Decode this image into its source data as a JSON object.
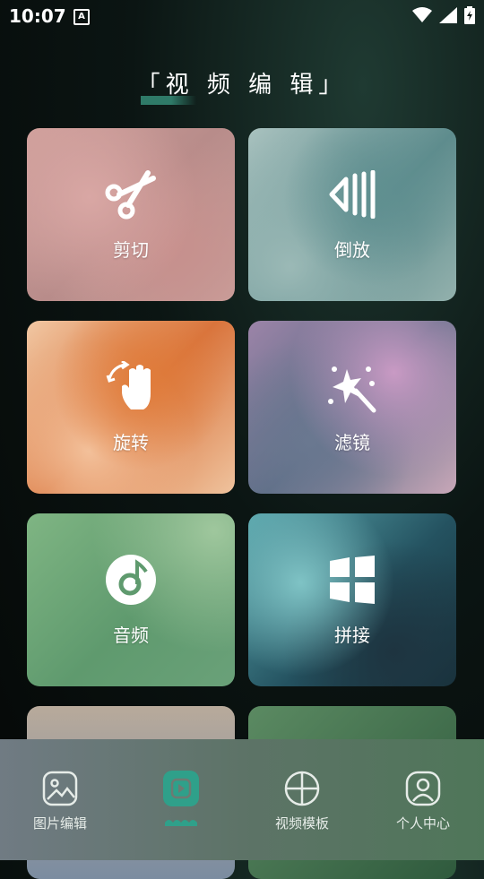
{
  "status_bar": {
    "time": "10:07",
    "notification_letter": "A"
  },
  "header": {
    "title": "「视 频 编 辑」"
  },
  "tiles": [
    {
      "label": "剪切",
      "icon": "scissors-icon"
    },
    {
      "label": "倒放",
      "icon": "reverse-play-icon"
    },
    {
      "label": "旋转",
      "icon": "rotate-hand-icon"
    },
    {
      "label": "滤镜",
      "icon": "magic-wand-icon"
    },
    {
      "label": "音频",
      "icon": "music-disc-icon"
    },
    {
      "label": "拼接",
      "icon": "grid-join-icon"
    }
  ],
  "tabbar": {
    "items": [
      {
        "label": "图片编辑",
        "icon": "image-icon"
      },
      {
        "label": "",
        "icon": "video-icon",
        "active": true
      },
      {
        "label": "视频模板",
        "icon": "template-circle-icon"
      },
      {
        "label": "个人中心",
        "icon": "user-icon"
      }
    ]
  },
  "colors": {
    "accent": "#2f7a68",
    "active_tab": "#2fa08a"
  }
}
